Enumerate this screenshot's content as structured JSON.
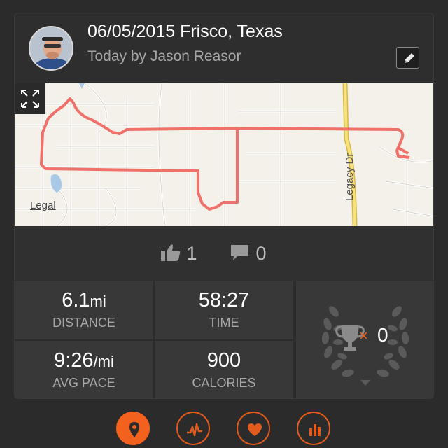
{
  "activity": {
    "title": "06/05/2015 Frisco, Texas",
    "subtitle": "Today by Jason Reasor"
  },
  "map": {
    "legal_label": "Legal",
    "road_label": "Legacy Dr",
    "route_color": "#f0706a"
  },
  "social": {
    "likes": "1",
    "comments": "0"
  },
  "stats": {
    "distance_value": "6.1",
    "distance_unit": "mi",
    "distance_label": "DISTANCE",
    "time_value": "58:27",
    "time_label": "TIME",
    "pace_value": "9:26",
    "pace_unit": "/mi",
    "pace_label": "AVG PACE",
    "calories_value": "900",
    "calories_label": "CALORIES",
    "trophy_count": "0",
    "trophy_multiplier": "×"
  },
  "nav": {
    "items": [
      "map-pin-icon",
      "activity-graph-icon",
      "heart-icon",
      "bar-chart-icon"
    ],
    "active": "map-pin-icon"
  },
  "colors": {
    "accent": "#f2611e",
    "card_bg": "#333333",
    "page_bg": "#2b2b2b"
  }
}
